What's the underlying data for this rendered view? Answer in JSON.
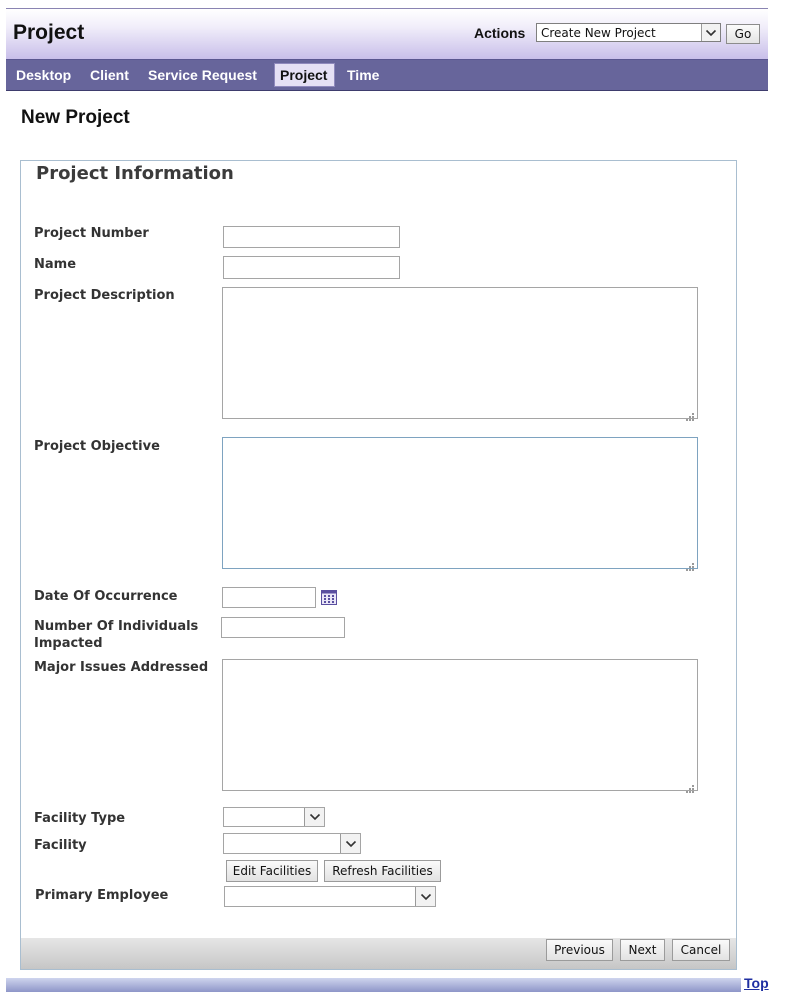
{
  "header": {
    "title": "Project",
    "actions_label": "Actions",
    "actions_selected": "Create New Project",
    "go_label": "Go"
  },
  "nav": {
    "items": [
      {
        "label": "Desktop",
        "active": false
      },
      {
        "label": "Client",
        "active": false
      },
      {
        "label": "Service Request",
        "active": false
      },
      {
        "label": "Project",
        "active": true
      },
      {
        "label": "Time",
        "active": false
      }
    ]
  },
  "page": {
    "title": "New Project"
  },
  "form": {
    "section_title": "Project Information",
    "project_number": {
      "label": "Project Number",
      "value": ""
    },
    "name": {
      "label": "Name",
      "value": ""
    },
    "project_description": {
      "label": "Project Description",
      "value": ""
    },
    "project_objective": {
      "label": "Project Objective",
      "value": ""
    },
    "date_of_occurrence": {
      "label": "Date Of Occurrence",
      "value": ""
    },
    "individuals_impacted": {
      "label_line1": "Number Of Individuals",
      "label_line2": "Impacted",
      "value": ""
    },
    "major_issues": {
      "label": "Major Issues Addressed",
      "value": ""
    },
    "facility_type": {
      "label": "Facility Type",
      "selected": ""
    },
    "facility": {
      "label": "Facility",
      "selected": ""
    },
    "edit_facilities_label": "Edit Facilities",
    "refresh_facilities_label": "Refresh Facilities",
    "primary_employee": {
      "label": "Primary Employee",
      "selected": ""
    }
  },
  "footer": {
    "previous_label": "Previous",
    "next_label": "Next",
    "cancel_label": "Cancel",
    "top_link": "Top"
  },
  "colors": {
    "nav_bg": "#67659b",
    "header_gradient_end": "#c7bde9",
    "active_tab_bg": "#e5e0f5",
    "link": "#1f2fa2"
  },
  "icons": {
    "calendar": "calendar-icon",
    "dropdown": "chevron-down-icon",
    "resize": "resize-grip-icon"
  }
}
